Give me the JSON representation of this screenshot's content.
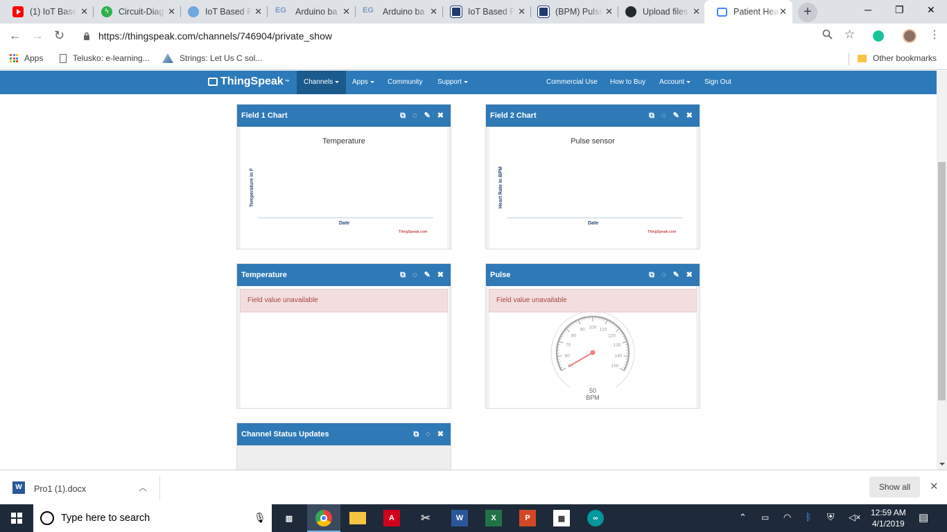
{
  "browser": {
    "tabs": [
      {
        "label": "(1) IoT Base",
        "favicon_color": "#ff0000",
        "favicon": "youtube-icon"
      },
      {
        "label": "Circuit-Diag",
        "favicon_color": "#2bb24c",
        "favicon": "circuit-icon"
      },
      {
        "label": "IoT Based P",
        "favicon_color": "#4a90d9",
        "favicon": "globe-icon"
      },
      {
        "label": "Arduino ba",
        "favicon_color": "#7a9cc6",
        "favicon": "eg-icon",
        "favicon_text": "EG"
      },
      {
        "label": "Arduino ba",
        "favicon_color": "#7a9cc6",
        "favicon": "eg-icon",
        "favicon_text": "EG"
      },
      {
        "label": "IoT Based P",
        "favicon_color": "#1e3a6e",
        "favicon": "e-icon"
      },
      {
        "label": "(BPM) Pulse",
        "favicon_color": "#1e3a6e",
        "favicon": "e-icon"
      },
      {
        "label": "Upload files",
        "favicon_color": "#24292e",
        "favicon": "github-icon"
      },
      {
        "label": "Patient Hea",
        "favicon_color": "#4285f4",
        "favicon": "chat-icon"
      }
    ],
    "url": "https://thingspeak.com/channels/746904/private_show",
    "bookmarks": {
      "apps": "Apps",
      "items": [
        "Telusko: e-learning...",
        "Strings: Let Us C sol..."
      ],
      "other": "Other bookmarks"
    }
  },
  "site": {
    "logo": "ThingSpeak",
    "logo_tm": "™",
    "nav": {
      "channels": "Channels",
      "apps": "Apps",
      "community": "Community",
      "support": "Support",
      "commercial": "Commercial Use",
      "how_to_buy": "How to Buy",
      "account": "Account",
      "sign_out": "Sign Out"
    }
  },
  "panels": {
    "field1": {
      "header": "Field 1 Chart",
      "chart_title": "Temperature",
      "ylabel": "Temperature in F",
      "xlabel": "Date",
      "credit": "ThingSpeak.com"
    },
    "field2": {
      "header": "Field 2 Chart",
      "chart_title": "Pulse sensor",
      "ylabel": "Heart Rate in BPM",
      "xlabel": "Date",
      "credit": "ThingSpeak.com"
    },
    "temp": {
      "header": "Temperature",
      "alert": "Field value unavailable"
    },
    "pulse": {
      "header": "Pulse",
      "alert": "Field value unavailable",
      "gauge_value": "50",
      "gauge_unit": "BPM",
      "gauge_ticks": [
        "50",
        "60",
        "70",
        "80",
        "90",
        "100",
        "110",
        "120",
        "130",
        "140",
        "150"
      ]
    },
    "status": {
      "header": "Channel Status Updates"
    }
  },
  "chart_data": [
    {
      "type": "line",
      "title": "Temperature",
      "xlabel": "Date",
      "ylabel": "Temperature in F",
      "series": []
    },
    {
      "type": "line",
      "title": "Pulse sensor",
      "xlabel": "Date",
      "ylabel": "Heart Rate in BPM",
      "series": []
    }
  ],
  "downloads": {
    "file": "Pro1 (1).docx",
    "show_all": "Show all"
  },
  "taskbar": {
    "search_placeholder": "Type here to search",
    "time": "12:59 AM",
    "date": "4/1/2019"
  }
}
